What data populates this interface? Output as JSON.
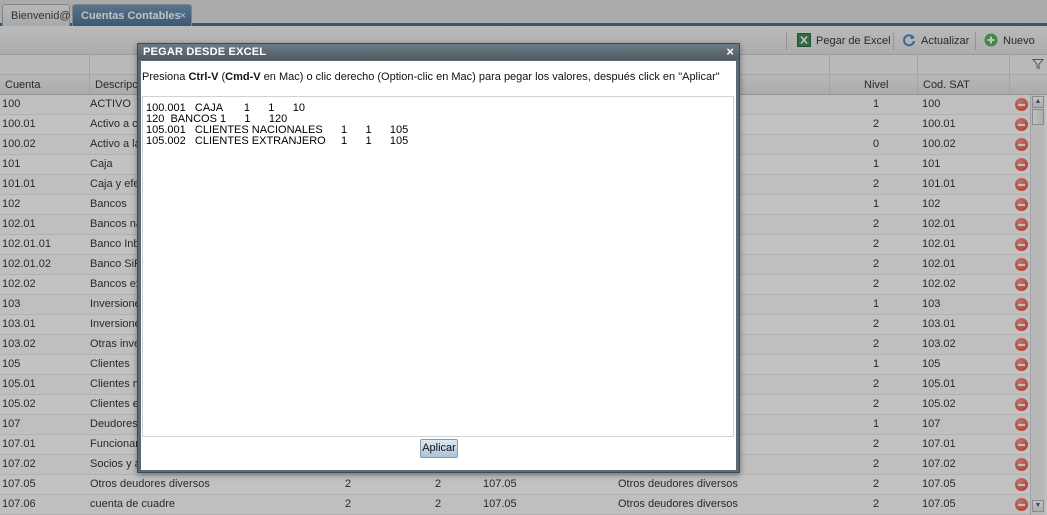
{
  "tabs": [
    {
      "label": "Bienvenid@",
      "active": false
    },
    {
      "label": "Cuentas Contables",
      "active": true,
      "close": "×"
    }
  ],
  "toolbar": {
    "excel_label": "Pegar de Excel",
    "refresh_label": "Actualizar",
    "new_label": "Nuevo"
  },
  "grid": {
    "headers": {
      "cuenta": "Cuenta",
      "descripcion": "Descripci",
      "nivel": "Nivel",
      "cod_sat": "Cod. SAT"
    },
    "rows": [
      {
        "cuenta": "100",
        "desc": "ACTIVO",
        "a": "",
        "b": "",
        "c": "",
        "d": "",
        "nivel": "1",
        "sat": "100"
      },
      {
        "cuenta": "100.01",
        "desc": "Activo a co",
        "a": "",
        "b": "",
        "c": "",
        "d": "",
        "nivel": "2",
        "sat": "100.01"
      },
      {
        "cuenta": "100.02",
        "desc": "Activo a la",
        "a": "",
        "b": "",
        "c": "",
        "d": "",
        "nivel": "0",
        "sat": "100.02"
      },
      {
        "cuenta": "101",
        "desc": "Caja",
        "a": "",
        "b": "",
        "c": "",
        "d": "",
        "nivel": "1",
        "sat": "101"
      },
      {
        "cuenta": "101.01",
        "desc": "Caja y efec",
        "a": "",
        "b": "",
        "c": "",
        "d": "",
        "nivel": "2",
        "sat": "101.01"
      },
      {
        "cuenta": "102",
        "desc": "Bancos",
        "a": "",
        "b": "",
        "c": "",
        "d": "",
        "nivel": "1",
        "sat": "102"
      },
      {
        "cuenta": "102.01",
        "desc": "Bancos na",
        "a": "",
        "b": "",
        "c": "",
        "d": "",
        "nivel": "2",
        "sat": "102.01"
      },
      {
        "cuenta": "102.01.01",
        "desc": "Banco Inbu",
        "a": "",
        "b": "",
        "c": "",
        "d": "",
        "nivel": "2",
        "sat": "102.01"
      },
      {
        "cuenta": "102.01.02",
        "desc": "Banco SiF",
        "a": "",
        "b": "",
        "c": "",
        "d": "",
        "nivel": "2",
        "sat": "102.01"
      },
      {
        "cuenta": "102.02",
        "desc": "Bancos ex",
        "a": "",
        "b": "",
        "c": "",
        "d": "",
        "nivel": "2",
        "sat": "102.02"
      },
      {
        "cuenta": "103",
        "desc": "Inversione",
        "a": "",
        "b": "",
        "c": "",
        "d": "",
        "nivel": "1",
        "sat": "103"
      },
      {
        "cuenta": "103.01",
        "desc": "Inversione",
        "a": "",
        "b": "",
        "c": "",
        "d": "",
        "nivel": "2",
        "sat": "103.01"
      },
      {
        "cuenta": "103.02",
        "desc": "Otras inver",
        "a": "",
        "b": "",
        "c": "",
        "d": "",
        "nivel": "2",
        "sat": "103.02"
      },
      {
        "cuenta": "105",
        "desc": "Clientes",
        "a": "",
        "b": "",
        "c": "",
        "d": "",
        "nivel": "1",
        "sat": "105"
      },
      {
        "cuenta": "105.01",
        "desc": "Clientes na",
        "a": "",
        "b": "",
        "c": "",
        "d": "",
        "nivel": "2",
        "sat": "105.01"
      },
      {
        "cuenta": "105.02",
        "desc": "Clientes ex",
        "a": "",
        "b": "",
        "c": "",
        "d": "",
        "nivel": "2",
        "sat": "105.02"
      },
      {
        "cuenta": "107",
        "desc": "Deudores d",
        "a": "",
        "b": "",
        "c": "",
        "d": "",
        "nivel": "1",
        "sat": "107"
      },
      {
        "cuenta": "107.01",
        "desc": "Funcionari",
        "a": "",
        "b": "",
        "c": "",
        "d": "",
        "nivel": "2",
        "sat": "107.01"
      },
      {
        "cuenta": "107.02",
        "desc": "Socios y a",
        "a": "",
        "b": "",
        "c": "",
        "d": "",
        "nivel": "2",
        "sat": "107.02"
      },
      {
        "cuenta": "107.05",
        "desc": "Otros deudores diversos",
        "a": "2",
        "b": "2",
        "c": "107.05",
        "d": "Otros deudores diversos",
        "nivel": "2",
        "sat": "107.05"
      },
      {
        "cuenta": "107.06",
        "desc": "cuenta de cuadre",
        "a": "2",
        "b": "2",
        "c": "107.05",
        "d": "Otros deudores diversos",
        "nivel": "2",
        "sat": "107.05"
      }
    ]
  },
  "dialog": {
    "title": "PEGAR DESDE EXCEL",
    "close": "×",
    "instr_1": "Presiona ",
    "instr_key1": "Ctrl-V",
    "instr_2": " (",
    "instr_key2": "Cmd-V",
    "instr_3": " en Mac) o clic derecho (Option-clic en Mac) para pegar los valores, después click en \"Aplicar\"",
    "pasted_lines": [
      "100.001   CAJA       1      1      10",
      "120  BANCOS 1      1      120",
      "105.001   CLIENTES NACIONALES      1      1      105",
      "105.002   CLIENTES EXTRANJERO     1      1      105"
    ],
    "apply_label": "Aplicar"
  }
}
